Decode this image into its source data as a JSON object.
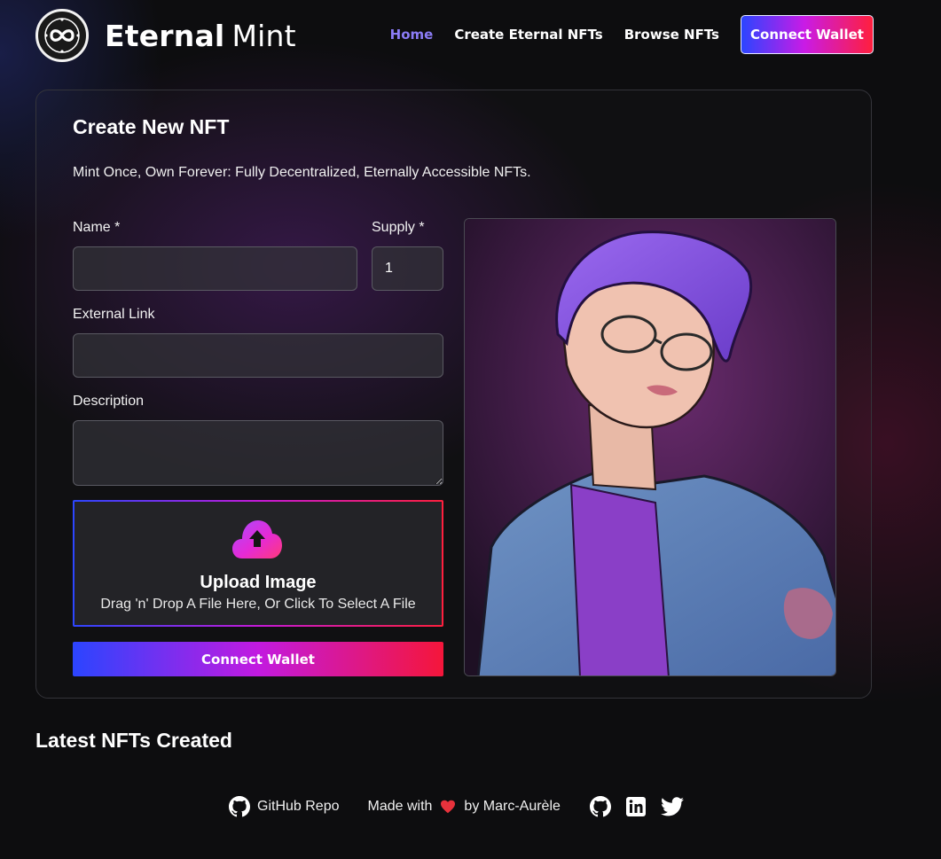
{
  "brand": {
    "name_bold": "Eternal",
    "name_light": "Mint"
  },
  "nav": {
    "items": [
      {
        "label": "Home",
        "active": true
      },
      {
        "label": "Create Eternal NFTs",
        "active": false
      },
      {
        "label": "Browse NFTs",
        "active": false
      }
    ],
    "connect_label": "Connect Wallet"
  },
  "form": {
    "title": "Create New NFT",
    "subtitle": "Mint Once, Own Forever: Fully Decentralized, Eternally Accessible NFTs.",
    "name_label": "Name *",
    "name_value": "",
    "supply_label": "Supply *",
    "supply_value": "1",
    "link_label": "External Link",
    "link_value": "",
    "description_label": "Description",
    "description_value": "",
    "upload_title": "Upload Image",
    "upload_hint": "Drag 'n' Drop A File Here, Or Click To Select A File",
    "submit_label": "Connect Wallet"
  },
  "latest": {
    "title": "Latest NFTs Created"
  },
  "footer": {
    "repo_label": "GitHub Repo",
    "made_prefix": "Made with",
    "made_suffix": "by Marc-Aurèle",
    "social_icons": [
      "github-icon",
      "linkedin-icon",
      "twitter-icon"
    ]
  },
  "colors": {
    "active_nav": "#8b7cf6",
    "gradient_start": "#2b45ff",
    "gradient_mid": "#c21ae0",
    "gradient_end": "#f5163a",
    "heart": "#e8323c"
  }
}
